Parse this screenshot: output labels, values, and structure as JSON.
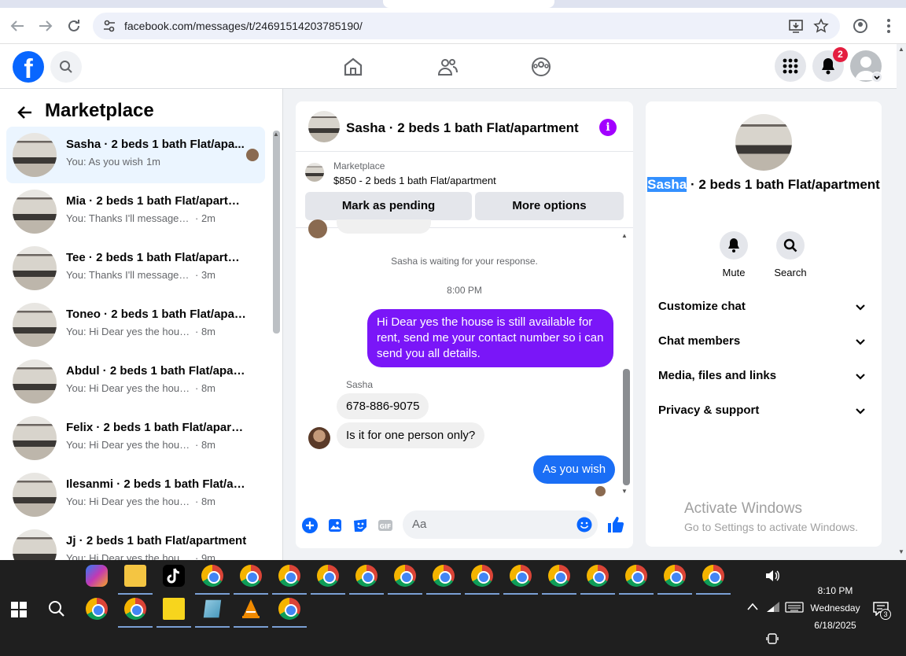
{
  "browser": {
    "url": "facebook.com/messages/t/24691514203785190/"
  },
  "fb_header": {
    "logo": "f",
    "notifications_count": "2"
  },
  "sidebar": {
    "title": "Marketplace",
    "conversations": [
      {
        "name": "Sasha · 2 beds 1 bath Flat/apa...",
        "preview": "You: As you wish",
        "time": "· 1m",
        "active": true
      },
      {
        "name": "Mia · 2 beds 1 bath Flat/apartme...",
        "preview": "You: Thanks I'll message you in a ...",
        "time": "· 2m"
      },
      {
        "name": "Tee · 2 beds 1 bath Flat/apartment",
        "preview": "You: Thanks I'll message you in a ...",
        "time": "· 3m"
      },
      {
        "name": "Toneo · 2 beds 1 bath Flat/apart...",
        "preview": "You: Hi Dear yes the house is still a...",
        "time": "· 8m"
      },
      {
        "name": "Abdul · 2 beds 1 bath Flat/apart...",
        "preview": "You: Hi Dear yes the house is still a...",
        "time": "· 8m"
      },
      {
        "name": "Felix · 2 beds 1 bath Flat/apartm...",
        "preview": "You: Hi Dear yes the house is still a...",
        "time": "· 8m"
      },
      {
        "name": "Ilesanmi · 2 beds 1 bath Flat/apa...",
        "preview": "You: Hi Dear yes the house is still a...",
        "time": "· 8m"
      },
      {
        "name": "Jj · 2 beds 1 bath Flat/apartment",
        "preview": "You: Hi Dear yes the house is still a...",
        "time": "· 9m"
      }
    ]
  },
  "chat": {
    "title": "Sasha · 2 beds 1 bath Flat/apartment",
    "marketplace_label": "Marketplace",
    "listing": "$850 - 2 beds 1 bath Flat/apartment",
    "mark_pending": "Mark as pending",
    "more_options": "More options",
    "waiting": "Sasha is waiting for your response.",
    "timestamp": "8:00 PM",
    "outgoing_1": "Hi Dear yes the house is still available for rent, send me your contact number so i can send you all details.",
    "sender_name": "Sasha",
    "incoming_1": "678-886-9075",
    "incoming_2": "Is it for one person only?",
    "outgoing_2": "As you wish",
    "composer_placeholder": "Aa"
  },
  "details": {
    "name_highlight": "Sasha",
    "name_rest": " · 2 beds 1 bath Flat/apartment",
    "mute": "Mute",
    "search": "Search",
    "sections": [
      "Customize chat",
      "Chat members",
      "Media, files and links",
      "Privacy & support"
    ]
  },
  "watermark": {
    "line1": "Activate Windows",
    "line2": "Go to Settings to activate Windows."
  },
  "taskbar": {
    "time": "8:10 PM",
    "day": "Wednesday",
    "date": "6/18/2025",
    "notification_count": "3"
  },
  "colors": {
    "fb_blue": "#0866ff",
    "messenger_purple": "#7a16f8",
    "badge_red": "#e41e3f"
  }
}
